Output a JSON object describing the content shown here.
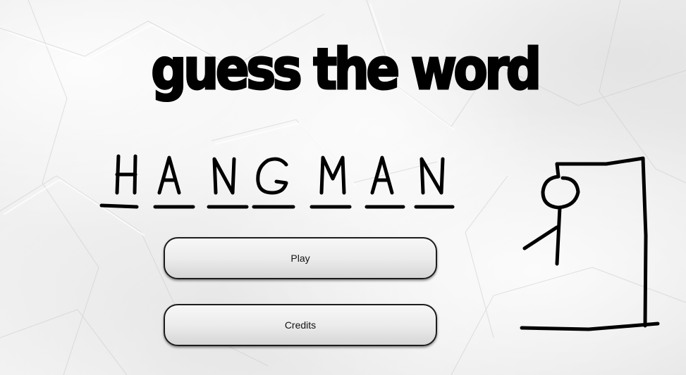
{
  "title": "guess the word",
  "logo": {
    "text": "HANGMAN",
    "letters": [
      "H",
      "A",
      "N",
      "G",
      "M",
      "A",
      "N"
    ]
  },
  "menu": {
    "play_label": "Play",
    "credits_label": "Credits"
  },
  "hangman_figure": {
    "icon": "gallows-with-partial-stick-figure",
    "parts_drawn": [
      "head",
      "body",
      "left-arm"
    ]
  },
  "colors": {
    "ink": "#000000",
    "paper": "#ececec",
    "button_border": "#1c1c1c"
  }
}
